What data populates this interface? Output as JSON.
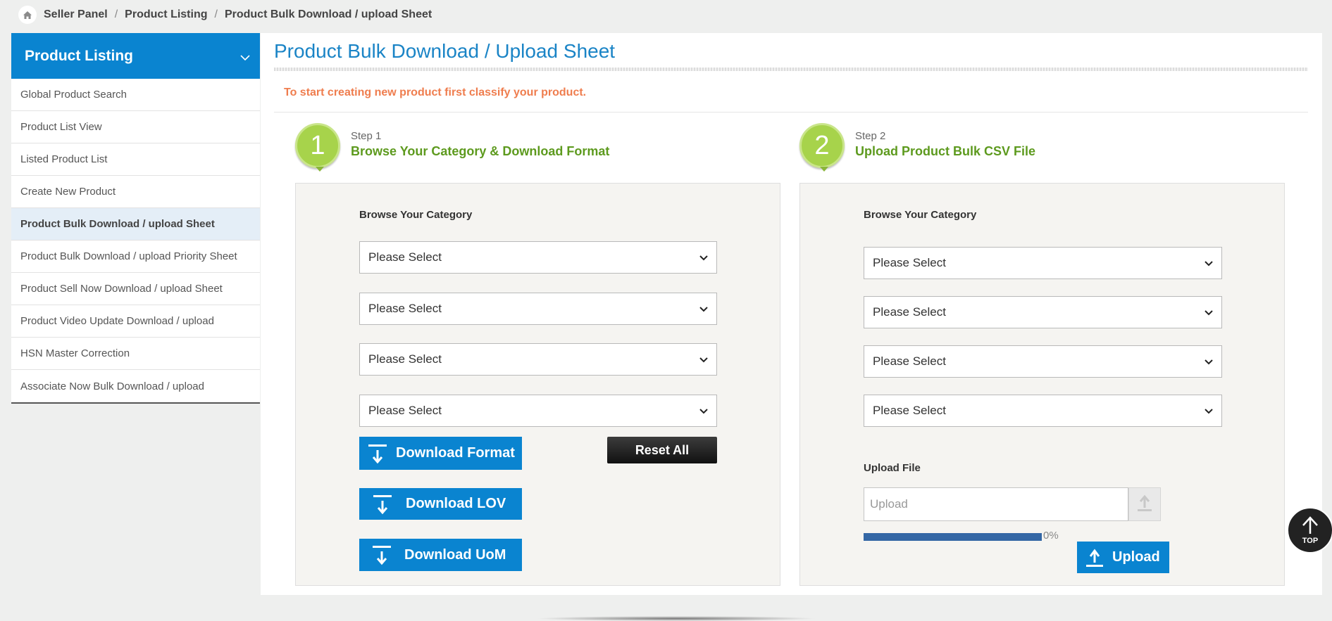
{
  "breadcrumb": {
    "items": [
      "Seller Panel",
      "Product Listing",
      "Product Bulk Download / upload Sheet"
    ]
  },
  "sidebar": {
    "heading": "Product Listing",
    "items": [
      {
        "label": "Global Product Search"
      },
      {
        "label": "Product List View"
      },
      {
        "label": "Listed Product List"
      },
      {
        "label": "Create New Product"
      },
      {
        "label": "Product Bulk Download / upload Sheet",
        "active": true
      },
      {
        "label": "Product Bulk Download / upload Priority Sheet"
      },
      {
        "label": "Product Sell Now Download / upload Sheet"
      },
      {
        "label": "Product Video Update Download / upload"
      },
      {
        "label": "HSN Master Correction"
      },
      {
        "label": "Associate Now Bulk Download / upload"
      }
    ]
  },
  "main": {
    "title": "Product Bulk Download / Upload Sheet",
    "notice": "To start creating new product first classify your product.",
    "step1": {
      "badge": "1",
      "step_label": "Step 1",
      "title": "Browse Your Category & Download Format",
      "category_label": "Browse Your Category",
      "selects": [
        "Please Select",
        "Please Select",
        "Please Select",
        "Please Select"
      ],
      "download_format": "Download Format",
      "download_lov": "Download LOV",
      "download_uom": "Download UoM",
      "reset_all": "Reset All"
    },
    "step2": {
      "badge": "2",
      "step_label": "Step 2",
      "title": "Upload Product Bulk CSV File",
      "category_label": "Browse Your Category",
      "selects": [
        "Please Select",
        "Please Select",
        "Please Select",
        "Please Select"
      ],
      "upload_file_label": "Upload File",
      "upload_placeholder": "Upload",
      "progress_text": "0%",
      "upload_button": "Upload"
    }
  },
  "scroll_top": {
    "label": "TOP"
  },
  "colors": {
    "accent_blue": "#0a84d0",
    "title_blue": "#1a84c6",
    "notice_orange": "#ef7d4e",
    "step_green": "#5d9a1e",
    "badge_green": "#a7d34b",
    "progress_blue": "#3467a5"
  },
  "icons": {
    "home": "home-icon",
    "chevron": "chevron-down-icon",
    "download": "download-icon",
    "upload": "upload-icon",
    "top": "arrow-up-icon"
  }
}
